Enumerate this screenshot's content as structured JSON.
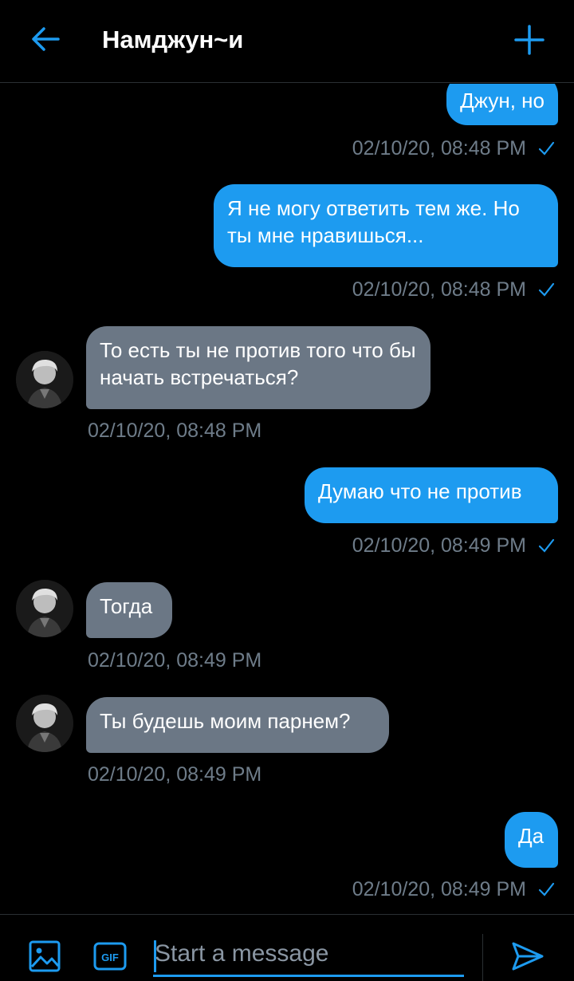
{
  "header": {
    "title": "Намджун~и"
  },
  "messages": [
    {
      "direction": "out",
      "text": "Джун, но",
      "timestamp": "02/10/20, 08:48 PM",
      "read": true
    },
    {
      "direction": "out",
      "text": "Я не могу ответить тем же. Но ты мне нравишься...",
      "timestamp": "02/10/20, 08:48 PM",
      "read": true
    },
    {
      "direction": "in",
      "text": "То есть ты не против того что бы начать встречаться?",
      "timestamp": "02/10/20, 08:48 PM"
    },
    {
      "direction": "out",
      "text": "Думаю что не против",
      "timestamp": "02/10/20, 08:49 PM",
      "read": true
    },
    {
      "direction": "in",
      "text": "Тогда",
      "timestamp": "02/10/20, 08:49 PM"
    },
    {
      "direction": "in",
      "text": "Ты будешь моим парнем?",
      "timestamp": "02/10/20, 08:49 PM"
    },
    {
      "direction": "out",
      "text": "Да",
      "timestamp": "02/10/20, 08:49 PM",
      "read": true
    }
  ],
  "composer": {
    "placeholder": "Start a message",
    "gif_label": "GIF"
  },
  "colors": {
    "accent": "#1d9bf0",
    "incoming_bubble": "#6b7785",
    "timestamp": "#6e7c89",
    "background": "#000000"
  },
  "icons": [
    "back-arrow-icon",
    "plus-icon",
    "check-icon",
    "image-icon",
    "gif-icon",
    "send-icon"
  ]
}
